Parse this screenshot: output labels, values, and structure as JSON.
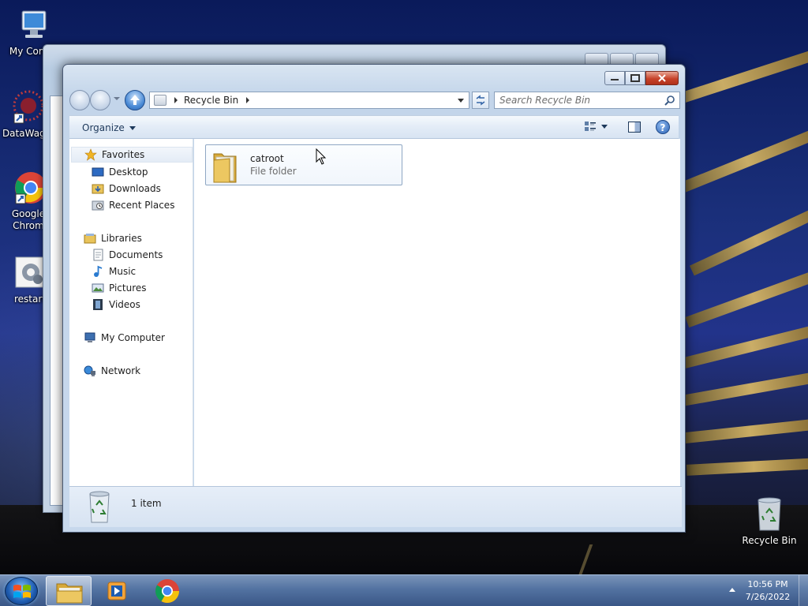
{
  "desktop": {
    "icons": [
      {
        "label": "My Comp"
      },
      {
        "label": "DataWage"
      },
      {
        "label": "Google\nChrom"
      },
      {
        "label": "restart"
      }
    ],
    "recycle_bin_label": "Recycle Bin"
  },
  "window": {
    "address": {
      "crumb": "Recycle Bin"
    },
    "search": {
      "placeholder": "Search Recycle Bin"
    },
    "toolbar": {
      "organize_label": "Organize"
    },
    "nav": {
      "favorites": {
        "label": "Favorites",
        "items": [
          "Desktop",
          "Downloads",
          "Recent Places"
        ]
      },
      "libraries": {
        "label": "Libraries",
        "items": [
          "Documents",
          "Music",
          "Pictures",
          "Videos"
        ]
      },
      "computer": "My Computer",
      "network": "Network"
    },
    "items": [
      {
        "name": "catroot",
        "type": "File folder"
      }
    ],
    "status": {
      "count": "1 item"
    }
  },
  "taskbar": {
    "clock": {
      "time": "10:56 PM",
      "date": "7/26/2022"
    }
  },
  "colors": {
    "accent": "#3566a8",
    "close_button": "#c7432a",
    "selection_border": "#8fa7c4"
  }
}
